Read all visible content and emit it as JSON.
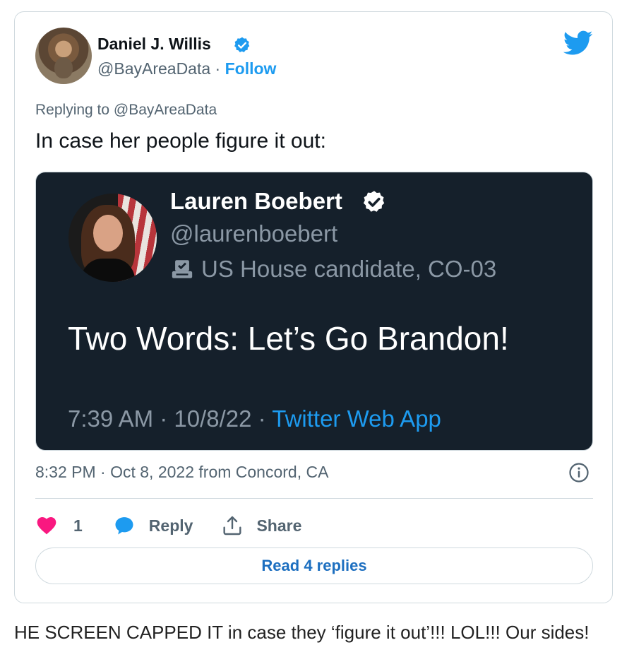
{
  "tweet": {
    "author_name": "Daniel J. Willis",
    "handle": "@BayAreaData",
    "separator": "·",
    "follow_label": "Follow",
    "replying_to": "Replying to @BayAreaData",
    "text": "In case her people figure it out:",
    "timestamp": "8:32 PM · Oct 8, 2022 from Concord, CA",
    "likes": "1",
    "reply_label": "Reply",
    "share_label": "Share",
    "read_replies_label": "Read 4 replies"
  },
  "quoted": {
    "author_name": "Lauren Boebert",
    "handle": "@laurenboebert",
    "label": "US House candidate, CO-03",
    "text": "Two Words: Let’s Go Brandon!",
    "time_date": "7:39 AM · 10/8/22 · ",
    "source": "Twitter Web App"
  },
  "caption": "HE SCREEN CAPPED IT in case they ‘figure it out’!!! LOL!!! Our sides!",
  "icons": {
    "logo": "twitter-bird-icon",
    "verified": "verified-badge-icon",
    "ballot": "ballot-box-icon",
    "info": "info-icon",
    "like": "heart-icon",
    "reply": "speech-bubble-icon",
    "share": "share-upload-icon"
  },
  "colors": {
    "accent": "#1d9bf0",
    "like": "#f91880",
    "quote_background": "#15202b",
    "read_replies_text": "#1d6fc0"
  }
}
